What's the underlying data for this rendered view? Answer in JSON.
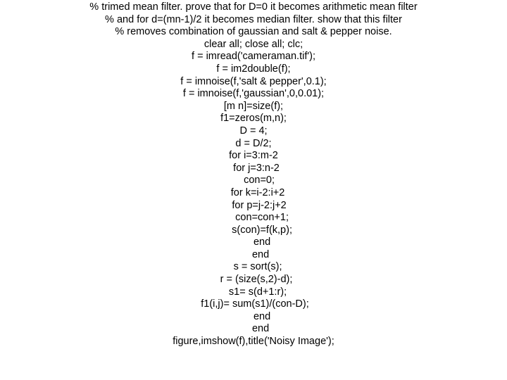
{
  "code": {
    "lines": [
      "% trimed mean filter. prove that for D=0 it becomes arithmetic mean filter",
      "% and for d=(mn-1)/2 it becomes median filter. show that this filter",
      "% removes combination of gaussian and salt & pepper noise.",
      "clear all; close all; clc;",
      "f = imread('cameraman.tif');",
      "f = im2double(f);",
      "f = imnoise(f,'salt & pepper',0.1);",
      "f = imnoise(f,'gaussian',0,0.01);",
      "[m n]=size(f);",
      "f1=zeros(m,n);",
      "D = 4;",
      "d = D/2;",
      "for i=3:m-2",
      "  for j=3:n-2",
      "    con=0;",
      "   for k=i-2:i+2",
      "    for p=j-2:j+2",
      "      con=con+1;",
      "      s(con)=f(k,p);",
      "      end",
      "     end",
      "   s = sort(s);",
      "  r = (size(s,2)-d);",
      "   s1= s(d+1:r);",
      " f1(i,j)= sum(s1)/(con-D);",
      "      end",
      "     end",
      "figure,imshow(f),title('Noisy Image');"
    ]
  }
}
